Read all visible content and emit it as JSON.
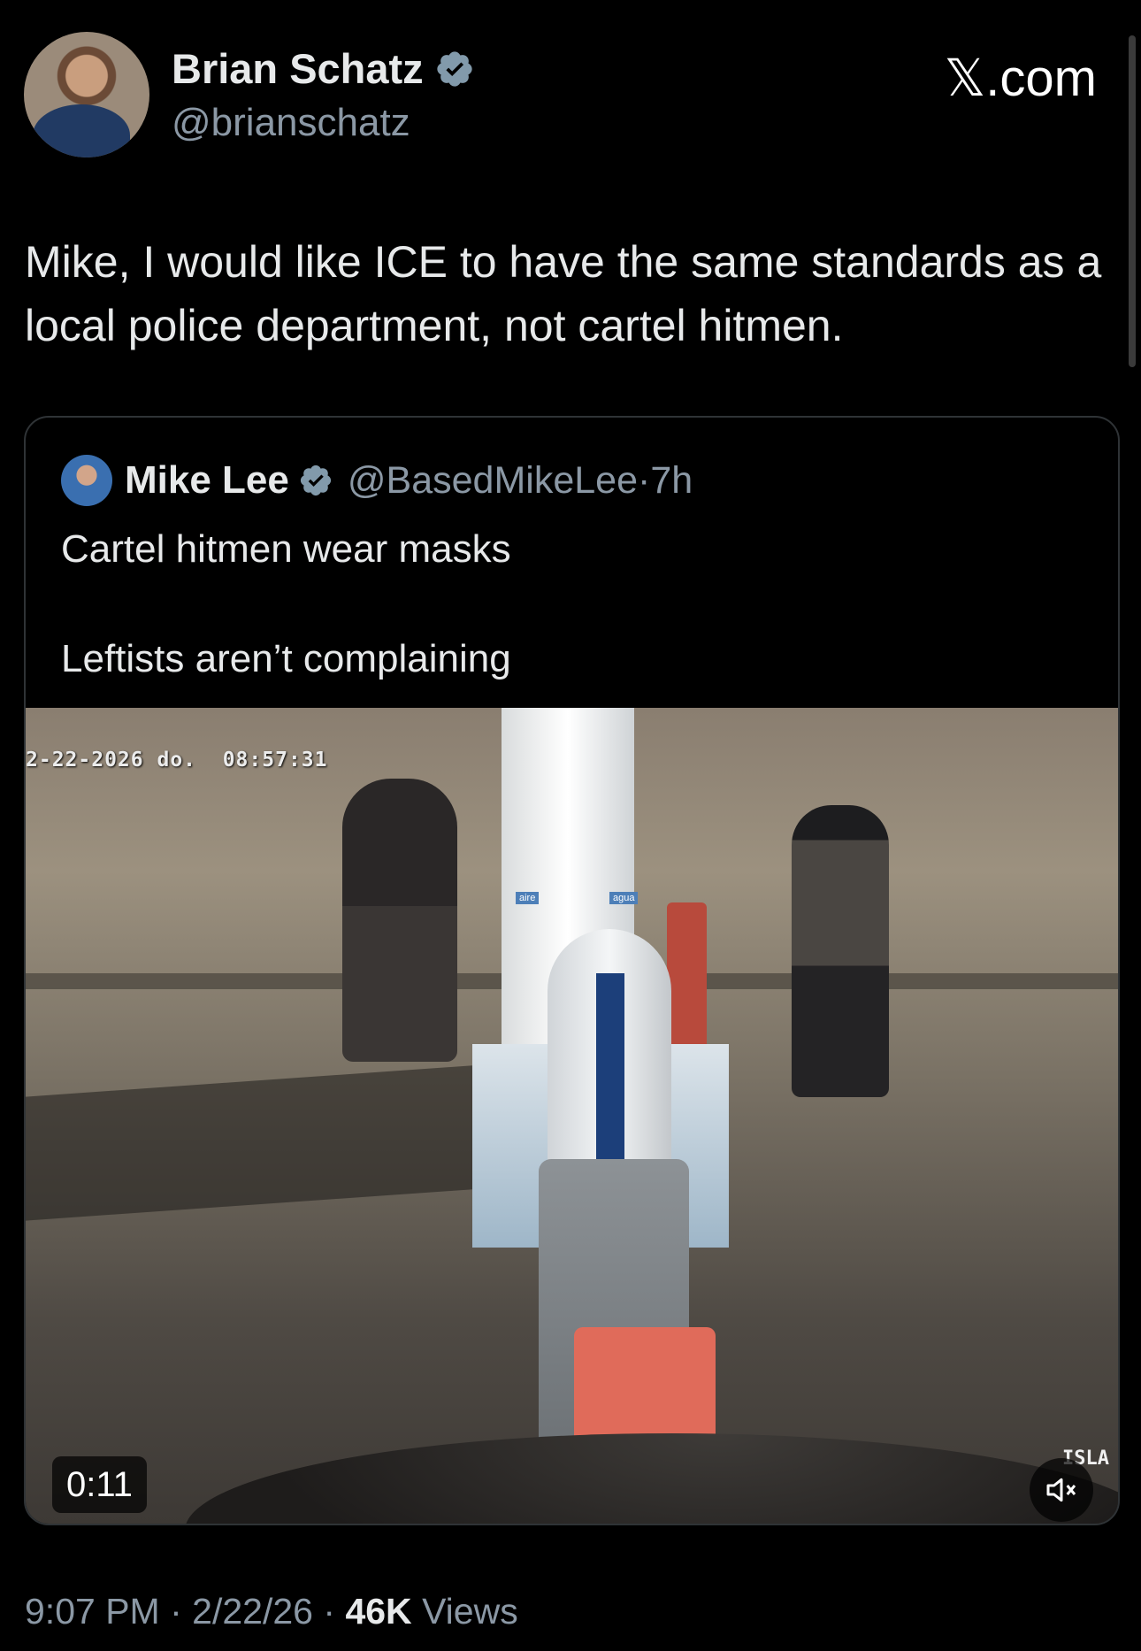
{
  "author": {
    "display_name": "Brian Schatz",
    "handle": "@brianschatz",
    "verified_icon": "verified-badge-icon"
  },
  "site_label": "𝕏.com",
  "tweet": {
    "text": "Mike, I would like ICE to have the same standards as a local police department, not cartel hitmen."
  },
  "quoted_tweet": {
    "display_name": "Mike Lee",
    "handle": "@BasedMikeLee",
    "separator": "·",
    "time": "7h",
    "text": "Cartel hitmen wear masks\n\nLeftists aren’t complaining",
    "media": {
      "cctv_timestamp": "2-22-2026 do.  08:57:31",
      "pump_label_left": "aire",
      "pump_label_right": "agua",
      "corner_watermark": "ISLA",
      "duration": "0:11",
      "mute_icon": "speaker-muted-icon"
    }
  },
  "footer": {
    "time": "9:07 PM",
    "sep1": "·",
    "date": "2/22/26",
    "sep2": "·",
    "views_count": "46K",
    "views_label": "Views"
  },
  "colors": {
    "background": "#000000",
    "text_primary": "#e7e9ea",
    "text_secondary": "#8b98a5",
    "verified": "#829aab",
    "border": "#2f3336"
  }
}
